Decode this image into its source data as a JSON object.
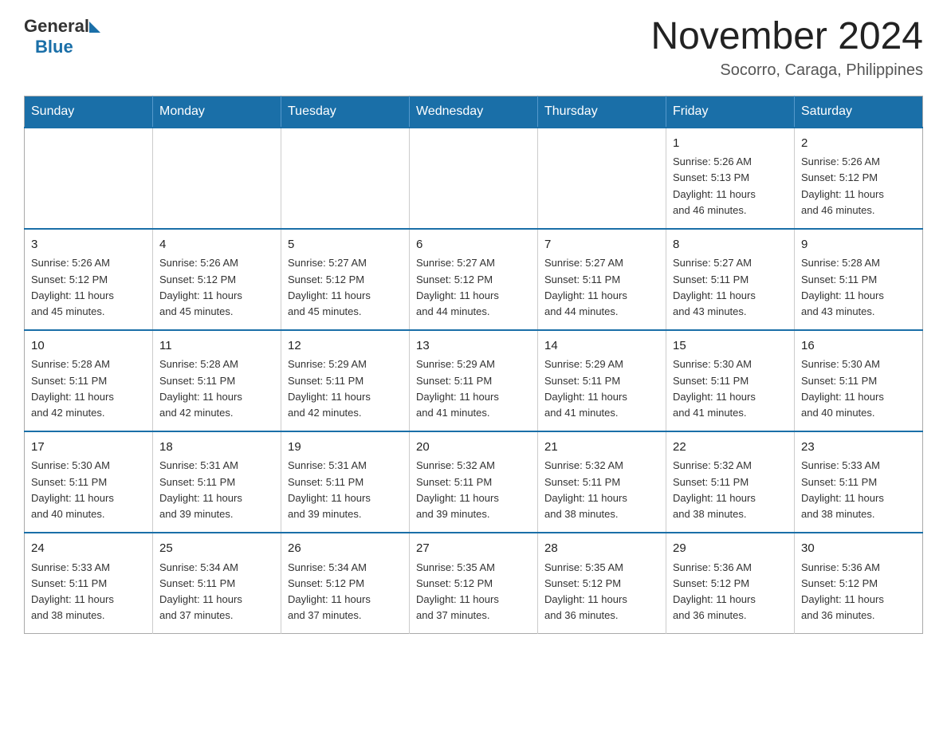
{
  "logo": {
    "general": "General",
    "blue": "Blue"
  },
  "title": {
    "month_year": "November 2024",
    "location": "Socorro, Caraga, Philippines"
  },
  "calendar": {
    "headers": [
      "Sunday",
      "Monday",
      "Tuesday",
      "Wednesday",
      "Thursday",
      "Friday",
      "Saturday"
    ],
    "weeks": [
      [
        {
          "day": "",
          "info": ""
        },
        {
          "day": "",
          "info": ""
        },
        {
          "day": "",
          "info": ""
        },
        {
          "day": "",
          "info": ""
        },
        {
          "day": "",
          "info": ""
        },
        {
          "day": "1",
          "info": "Sunrise: 5:26 AM\nSunset: 5:13 PM\nDaylight: 11 hours\nand 46 minutes."
        },
        {
          "day": "2",
          "info": "Sunrise: 5:26 AM\nSunset: 5:12 PM\nDaylight: 11 hours\nand 46 minutes."
        }
      ],
      [
        {
          "day": "3",
          "info": "Sunrise: 5:26 AM\nSunset: 5:12 PM\nDaylight: 11 hours\nand 45 minutes."
        },
        {
          "day": "4",
          "info": "Sunrise: 5:26 AM\nSunset: 5:12 PM\nDaylight: 11 hours\nand 45 minutes."
        },
        {
          "day": "5",
          "info": "Sunrise: 5:27 AM\nSunset: 5:12 PM\nDaylight: 11 hours\nand 45 minutes."
        },
        {
          "day": "6",
          "info": "Sunrise: 5:27 AM\nSunset: 5:12 PM\nDaylight: 11 hours\nand 44 minutes."
        },
        {
          "day": "7",
          "info": "Sunrise: 5:27 AM\nSunset: 5:11 PM\nDaylight: 11 hours\nand 44 minutes."
        },
        {
          "day": "8",
          "info": "Sunrise: 5:27 AM\nSunset: 5:11 PM\nDaylight: 11 hours\nand 43 minutes."
        },
        {
          "day": "9",
          "info": "Sunrise: 5:28 AM\nSunset: 5:11 PM\nDaylight: 11 hours\nand 43 minutes."
        }
      ],
      [
        {
          "day": "10",
          "info": "Sunrise: 5:28 AM\nSunset: 5:11 PM\nDaylight: 11 hours\nand 42 minutes."
        },
        {
          "day": "11",
          "info": "Sunrise: 5:28 AM\nSunset: 5:11 PM\nDaylight: 11 hours\nand 42 minutes."
        },
        {
          "day": "12",
          "info": "Sunrise: 5:29 AM\nSunset: 5:11 PM\nDaylight: 11 hours\nand 42 minutes."
        },
        {
          "day": "13",
          "info": "Sunrise: 5:29 AM\nSunset: 5:11 PM\nDaylight: 11 hours\nand 41 minutes."
        },
        {
          "day": "14",
          "info": "Sunrise: 5:29 AM\nSunset: 5:11 PM\nDaylight: 11 hours\nand 41 minutes."
        },
        {
          "day": "15",
          "info": "Sunrise: 5:30 AM\nSunset: 5:11 PM\nDaylight: 11 hours\nand 41 minutes."
        },
        {
          "day": "16",
          "info": "Sunrise: 5:30 AM\nSunset: 5:11 PM\nDaylight: 11 hours\nand 40 minutes."
        }
      ],
      [
        {
          "day": "17",
          "info": "Sunrise: 5:30 AM\nSunset: 5:11 PM\nDaylight: 11 hours\nand 40 minutes."
        },
        {
          "day": "18",
          "info": "Sunrise: 5:31 AM\nSunset: 5:11 PM\nDaylight: 11 hours\nand 39 minutes."
        },
        {
          "day": "19",
          "info": "Sunrise: 5:31 AM\nSunset: 5:11 PM\nDaylight: 11 hours\nand 39 minutes."
        },
        {
          "day": "20",
          "info": "Sunrise: 5:32 AM\nSunset: 5:11 PM\nDaylight: 11 hours\nand 39 minutes."
        },
        {
          "day": "21",
          "info": "Sunrise: 5:32 AM\nSunset: 5:11 PM\nDaylight: 11 hours\nand 38 minutes."
        },
        {
          "day": "22",
          "info": "Sunrise: 5:32 AM\nSunset: 5:11 PM\nDaylight: 11 hours\nand 38 minutes."
        },
        {
          "day": "23",
          "info": "Sunrise: 5:33 AM\nSunset: 5:11 PM\nDaylight: 11 hours\nand 38 minutes."
        }
      ],
      [
        {
          "day": "24",
          "info": "Sunrise: 5:33 AM\nSunset: 5:11 PM\nDaylight: 11 hours\nand 38 minutes."
        },
        {
          "day": "25",
          "info": "Sunrise: 5:34 AM\nSunset: 5:11 PM\nDaylight: 11 hours\nand 37 minutes."
        },
        {
          "day": "26",
          "info": "Sunrise: 5:34 AM\nSunset: 5:12 PM\nDaylight: 11 hours\nand 37 minutes."
        },
        {
          "day": "27",
          "info": "Sunrise: 5:35 AM\nSunset: 5:12 PM\nDaylight: 11 hours\nand 37 minutes."
        },
        {
          "day": "28",
          "info": "Sunrise: 5:35 AM\nSunset: 5:12 PM\nDaylight: 11 hours\nand 36 minutes."
        },
        {
          "day": "29",
          "info": "Sunrise: 5:36 AM\nSunset: 5:12 PM\nDaylight: 11 hours\nand 36 minutes."
        },
        {
          "day": "30",
          "info": "Sunrise: 5:36 AM\nSunset: 5:12 PM\nDaylight: 11 hours\nand 36 minutes."
        }
      ]
    ]
  }
}
